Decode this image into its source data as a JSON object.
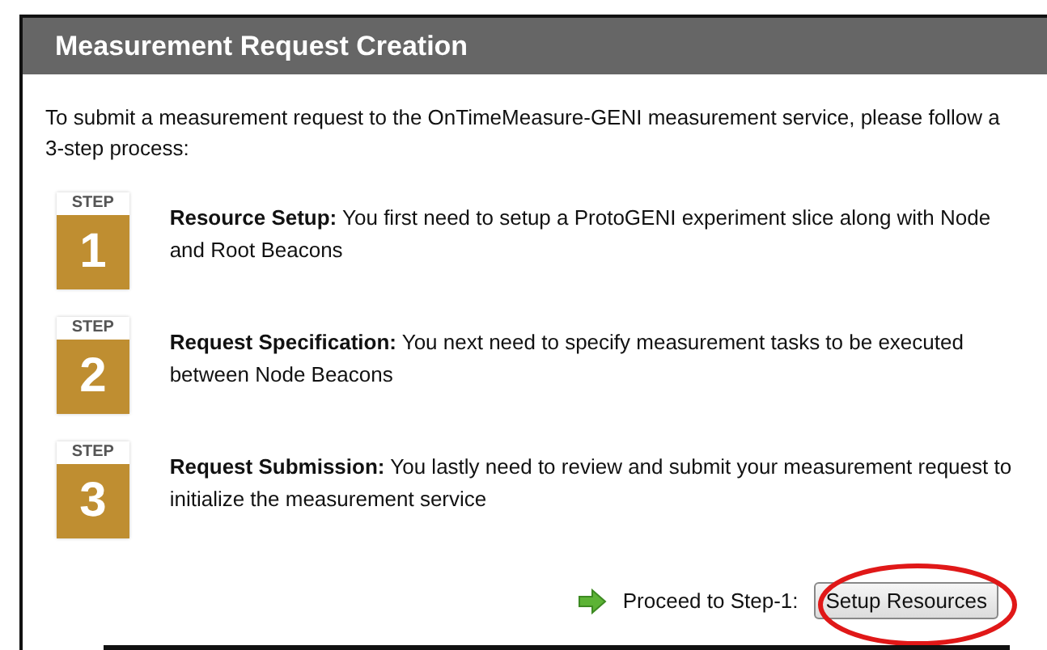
{
  "panel": {
    "title": "Measurement Request Creation",
    "intro": "To submit a measurement request to the OnTimeMeasure-GENI measurement service, please follow a 3-step process:",
    "steps": [
      {
        "badge_label": "STEP",
        "number": "1",
        "text": "**Resource Setup:** You first need to setup a ProtoGENI experiment slice along with Node and Root Beacons"
      },
      {
        "badge_label": "STEP",
        "number": "2",
        "text": "**Request Specification:** You next need to specify measurement tasks to be executed between Node Beacons"
      },
      {
        "badge_label": "STEP",
        "number": "3",
        "text": "**Request Submission:** You lastly need to review and submit your measurement request to initialize the measurement service"
      }
    ],
    "proceed": {
      "label": "Proceed to Step-1:",
      "button": "Setup Resources",
      "highlighted": true
    }
  }
}
